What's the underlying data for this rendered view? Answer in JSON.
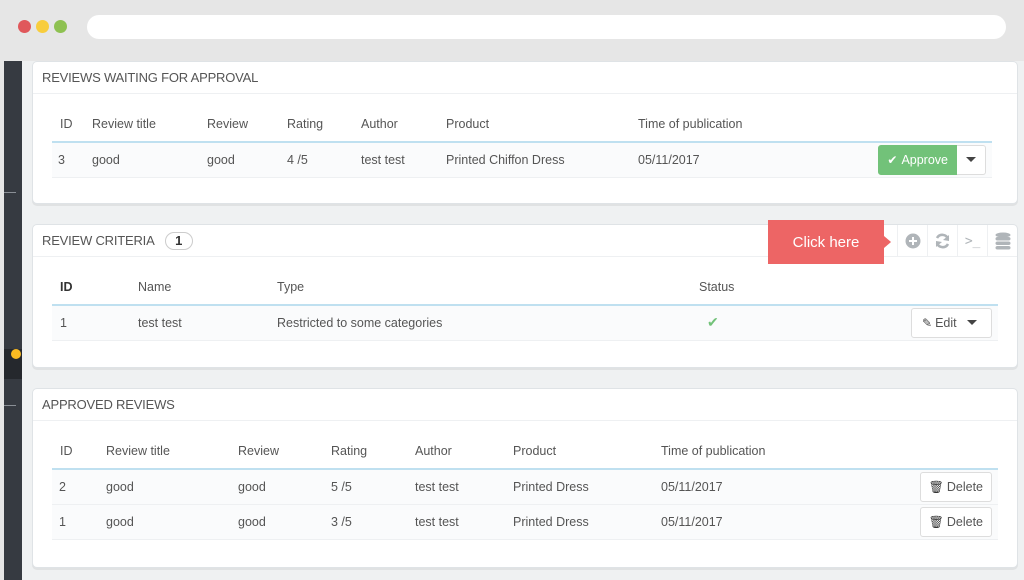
{
  "browser": {
    "dots": [
      {
        "name": "close",
        "color": "#e0585b"
      },
      {
        "name": "minimize",
        "color": "#f8cd3d"
      },
      {
        "name": "maximize",
        "color": "#8ec151"
      }
    ],
    "url": ""
  },
  "colors": {
    "approve": "#72c279",
    "tooltip": "#ed6565",
    "status_ok": "#72c279",
    "sidebar": "#363a41",
    "sidebar_indicator": "#fbbb22"
  },
  "pending": {
    "title": "REVIEWS WAITING FOR APPROVAL",
    "columns": [
      "ID",
      "Review title",
      "Review",
      "Rating",
      "Author",
      "Product",
      "Time of publication"
    ],
    "rows": [
      {
        "id": "3",
        "title": "good",
        "review": "good",
        "rating": "4 /5",
        "author": "test test",
        "product": "Printed Chiffon Dress",
        "time": "05/11/2017"
      }
    ],
    "approve_label": "Approve",
    "approve_icon": "check-icon"
  },
  "criteria": {
    "title": "REVIEW CRITERIA",
    "count": "1",
    "toolbar": [
      {
        "name": "add-icon",
        "glyph": "⊕"
      },
      {
        "name": "refresh-icon",
        "glyph": "⟳"
      },
      {
        "name": "sql-query-icon",
        "glyph": ">_"
      },
      {
        "name": "database-icon",
        "glyph": "≣"
      }
    ],
    "columns": [
      "ID",
      "Name",
      "Type",
      "Status"
    ],
    "rows": [
      {
        "id": "1",
        "name": "test test",
        "type": "Restricted to some categories",
        "status": "enabled"
      }
    ],
    "edit_label": "Edit",
    "edit_icon": "pencil-icon"
  },
  "tooltip": {
    "text": "Click here"
  },
  "approved": {
    "title": "APPROVED REVIEWS",
    "columns": [
      "ID",
      "Review title",
      "Review",
      "Rating",
      "Author",
      "Product",
      "Time of publication"
    ],
    "rows": [
      {
        "id": "2",
        "title": "good",
        "review": "good",
        "rating": "5 /5",
        "author": "test test",
        "product": "Printed Dress",
        "time": "05/11/2017"
      },
      {
        "id": "1",
        "title": "good",
        "review": "good",
        "rating": "3 /5",
        "author": "test test",
        "product": "Printed Dress",
        "time": "05/11/2017"
      }
    ],
    "delete_label": "Delete",
    "delete_icon": "trash-icon"
  }
}
